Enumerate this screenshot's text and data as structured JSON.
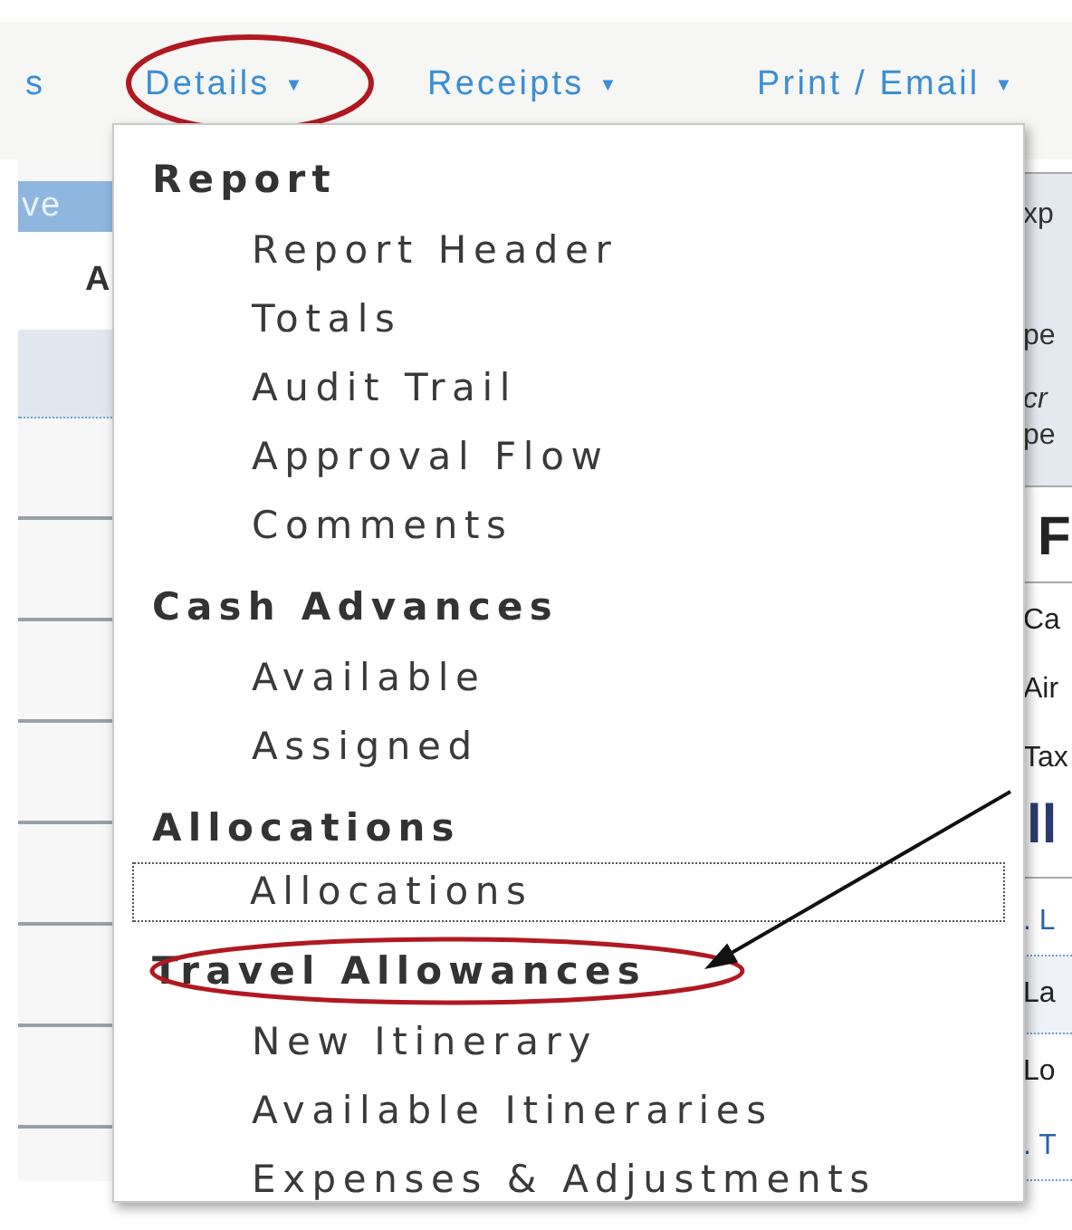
{
  "nav": [
    {
      "label": "s",
      "caret": false,
      "circled": false
    },
    {
      "label": "Details",
      "caret": true,
      "circled": true
    },
    {
      "label": "Receipts",
      "caret": true,
      "circled": false
    },
    {
      "label": "Print / Email",
      "caret": true,
      "circled": false
    }
  ],
  "caret": "▼",
  "left_panel": [
    {
      "kind": "button",
      "text": "ve"
    },
    {
      "kind": "header",
      "text": "A"
    },
    {
      "kind": "selected"
    },
    {
      "kind": "row"
    },
    {
      "kind": "row"
    },
    {
      "kind": "row"
    },
    {
      "kind": "row"
    },
    {
      "kind": "row"
    },
    {
      "kind": "row"
    },
    {
      "kind": "row"
    }
  ],
  "right_panel": [
    {
      "kind": "shaded",
      "text": "xp"
    },
    {
      "kind": "shaded",
      "text": "pe"
    },
    {
      "kind": "shaded-italic",
      "text": "cr"
    },
    {
      "kind": "shaded",
      "text": "pe"
    },
    {
      "kind": "title",
      "text": "F"
    },
    {
      "kind": "plain",
      "text": "Ca"
    },
    {
      "kind": "plain",
      "text": "Air"
    },
    {
      "kind": "plain",
      "text": "Tax"
    },
    {
      "kind": "section",
      "text": "ll"
    },
    {
      "kind": "link",
      "text": ". L"
    },
    {
      "kind": "alt",
      "text": "La"
    },
    {
      "kind": "plain",
      "text": "Lo"
    },
    {
      "kind": "link",
      "text": ". T"
    }
  ],
  "menu": {
    "arrow": true,
    "sections": [
      {
        "title": "Report",
        "circled": false,
        "items": [
          {
            "label": "Report Header",
            "focused": false
          },
          {
            "label": "Totals",
            "focused": false
          },
          {
            "label": "Audit Trail",
            "focused": false
          },
          {
            "label": "Approval Flow",
            "focused": false
          },
          {
            "label": "Comments",
            "focused": false
          }
        ]
      },
      {
        "title": "Cash Advances",
        "circled": false,
        "items": [
          {
            "label": "Available",
            "focused": false
          },
          {
            "label": "Assigned",
            "focused": false
          }
        ]
      },
      {
        "title": "Allocations",
        "circled": false,
        "items": [
          {
            "label": "Allocations",
            "focused": true
          }
        ]
      },
      {
        "title": "Travel Allowances",
        "circled": true,
        "items": [
          {
            "label": "New Itinerary",
            "focused": false
          },
          {
            "label": "Available Itineraries",
            "focused": false
          },
          {
            "label": "Expenses & Adjustments",
            "focused": false
          }
        ]
      }
    ]
  }
}
